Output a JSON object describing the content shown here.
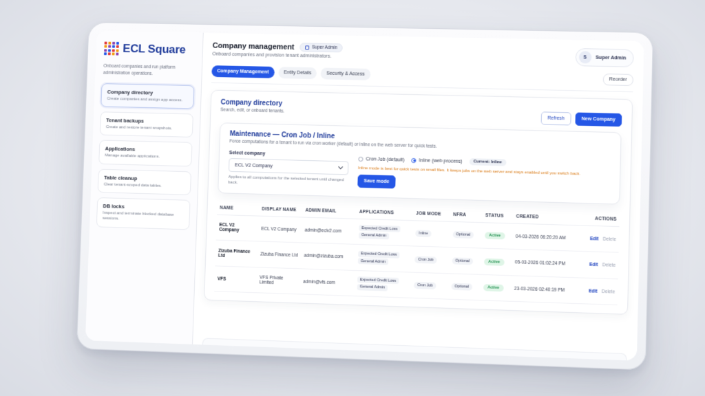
{
  "brand": {
    "name": "ECL Square",
    "tagline": "Onboard companies and run platform administration operations.",
    "colors": [
      "#e03b3b",
      "#f39c12",
      "#8e44ad",
      "#2557e6"
    ]
  },
  "sidebar": {
    "items": [
      {
        "title": "Company directory",
        "desc": "Create companies and assign app access."
      },
      {
        "title": "Tenant backups",
        "desc": "Create and restore tenant snapshots."
      },
      {
        "title": "Applications",
        "desc": "Manage available applications."
      },
      {
        "title": "Table cleanup",
        "desc": "Clear tenant-scoped data tables."
      },
      {
        "title": "DB locks",
        "desc": "Inspect and terminate blocked database sessions."
      }
    ]
  },
  "header": {
    "title": "Company management",
    "role_badge": "Super Admin",
    "subtitle": "Onboard companies and provision tenant administrators.",
    "user": {
      "initial": "S",
      "name": "Super Admin"
    }
  },
  "tabs": [
    "Company Management",
    "Entity Details",
    "Security & Access"
  ],
  "reorder_label": "Reorder",
  "directory": {
    "title": "Company directory",
    "subtitle": "Search, edit, or onboard tenants.",
    "refresh_label": "Refresh",
    "new_label": "New Company"
  },
  "maintenance": {
    "title": "Maintenance — Cron Job / Inline",
    "subtitle": "Force computations for a tenant to run via cron worker (default) or inline on the web server for quick tests.",
    "select_label": "Select company",
    "selected_company": "ECL V2 Company",
    "note": "Applies to all computations for the selected tenant until changed back.",
    "option_cron": "Cron Job (default)",
    "option_inline": "Inline (web process)",
    "current": "Current: Inline",
    "warning": "Inline mode is best for quick tests on small files. It keeps jobs on the web server and stays enabled until you switch back.",
    "save_label": "Save mode"
  },
  "table": {
    "headers": [
      "NAME",
      "DISPLAY NAME",
      "ADMIN EMAIL",
      "APPLICATIONS",
      "JOB MODE",
      "NFRA",
      "STATUS",
      "CREATED",
      "ACTIONS"
    ],
    "rows": [
      {
        "name": "ECL V2 Company",
        "display": "ECL V2 Company",
        "email": "admin@eclv2.com",
        "apps": [
          "Expected Credit Loss",
          "General Admin"
        ],
        "mode": "Inline",
        "nfra": "Optional",
        "status": "Active",
        "created": "04-03-2026 06:20:20 AM"
      },
      {
        "name": "Zizuba Finance Ltd",
        "display": "Zizuba Finance Ltd",
        "email": "admin@zizuba.com",
        "apps": [
          "Expected Credit Loss",
          "General Admin"
        ],
        "mode": "Cron Job",
        "nfra": "Optional",
        "status": "Active",
        "created": "05-03-2026 01:02:24 PM"
      },
      {
        "name": "VFS",
        "display": "VFS Private Limited",
        "email": "admin@vfs.com",
        "apps": [
          "Expected Credit Loss",
          "General Admin"
        ],
        "mode": "Cron Job",
        "nfra": "Optional",
        "status": "Active",
        "created": "23-03-2026 02:40:19 PM"
      }
    ],
    "edit_label": "Edit",
    "delete_label": "Delete"
  }
}
